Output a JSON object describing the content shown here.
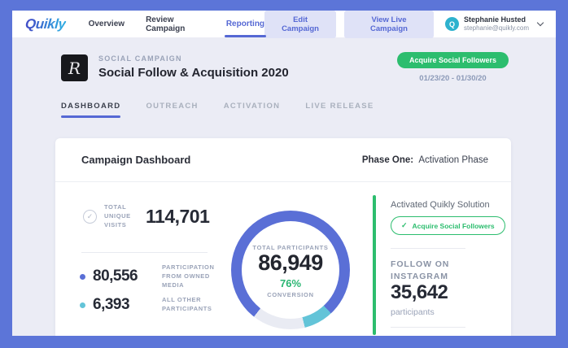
{
  "topnav": {
    "logo_text": "Quikly",
    "items": [
      {
        "label": "Overview",
        "active": false
      },
      {
        "label": "Review Campaign",
        "active": false
      },
      {
        "label": "Reporting",
        "active": true
      }
    ],
    "edit_button": "Edit Campaign",
    "view_live_button": "View Live Campaign",
    "user": {
      "name": "Stephanie Husted",
      "email": "stephanie@quikly.com",
      "avatar_letter": "Q"
    }
  },
  "campaign_header": {
    "monogram_letter": "R",
    "type_label": "SOCIAL CAMPAIGN",
    "title": "Social Follow & Acquisition 2020",
    "cta_button": "Acquire Social Followers",
    "date_range": "01/23/20 - 01/30/20"
  },
  "tabs": [
    {
      "label": "DASHBOARD",
      "active": true
    },
    {
      "label": "OUTREACH",
      "active": false
    },
    {
      "label": "ACTIVATION",
      "active": false
    },
    {
      "label": "LIVE RELEASE",
      "active": false
    }
  ],
  "dashboard": {
    "title": "Campaign Dashboard",
    "phase_label": "Phase One:",
    "phase_value": "Activation Phase",
    "visits": {
      "label": "TOTAL UNIQUE VISITS",
      "value": "114,701"
    },
    "owned_media": {
      "value": "80,556",
      "label": "PARTICIPATION FROM OWNED MEDIA",
      "color": "#5a6fd6"
    },
    "all_other": {
      "value": "6,393",
      "label": "ALL OTHER PARTICIPANTS",
      "color": "#63c4d8"
    },
    "donut_center": {
      "label": "TOTAL PARTICIPANTS",
      "value": "86,949",
      "conversion": "76%",
      "conversion_label": "CONVERSION"
    },
    "solution_panel": {
      "heading": "Activated Quikly Solution",
      "badge_check": "✓",
      "badge_label": "Acquire Social Followers",
      "accent_color": "#2cbd6e"
    },
    "instagram_panel": {
      "heading": "FOLLOW ON INSTAGRAM",
      "value": "35,642",
      "unit": "participants"
    }
  },
  "chart_data": {
    "type": "pie",
    "variant": "donut",
    "title": "TOTAL PARTICIPANTS",
    "center_value": 86949,
    "conversion_pct": 76,
    "series": [
      {
        "name": "Participation from owned media",
        "value": 80556,
        "color": "#5a6fd6"
      },
      {
        "name": "All other participants",
        "value": 6393,
        "color": "#63c4d8"
      }
    ],
    "total_unique_visits": 114701,
    "legend_position": "left",
    "render": {
      "start_deg": 218,
      "segment_degs": [
        279,
        29,
        52
      ],
      "segment_colors": [
        "#5a6fd6",
        "#63c4d8",
        "#e9ebf3"
      ]
    }
  },
  "colors": {
    "frame": "#5c75d8",
    "background": "#ebecf5",
    "accent_blue": "#5568d4",
    "accent_green": "#2cbd6e",
    "accent_teal": "#63c4d8"
  }
}
